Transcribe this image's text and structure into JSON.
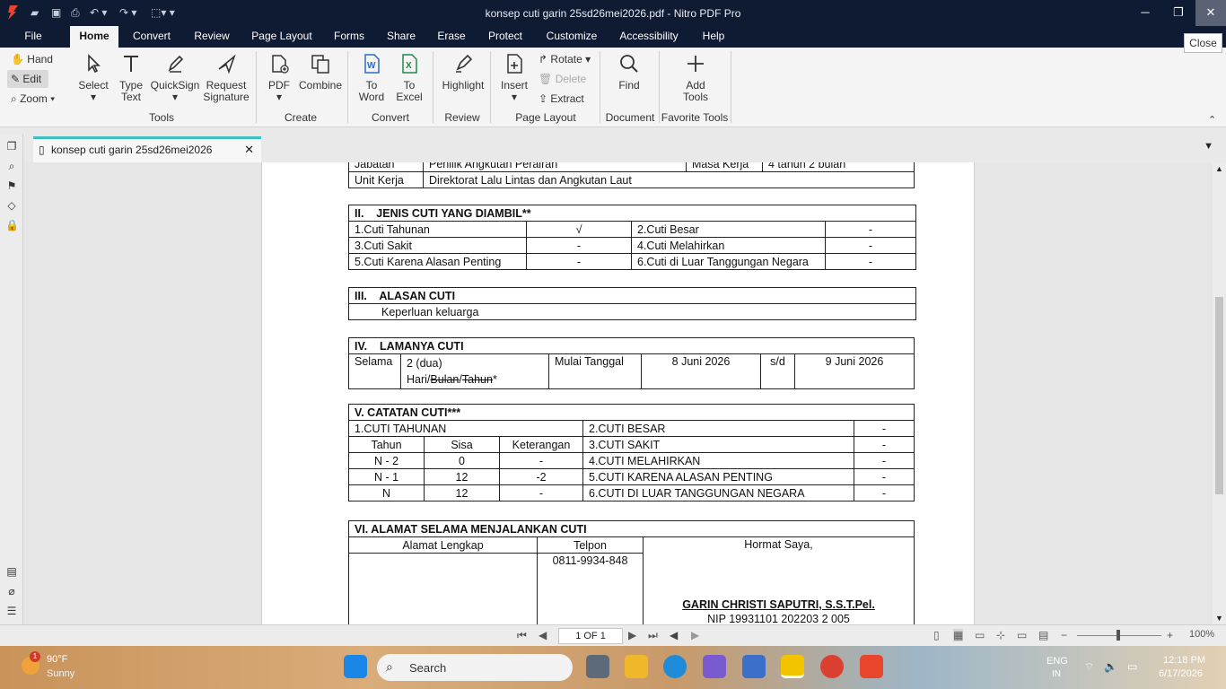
{
  "window": {
    "title": "konsep cuti garin 25sd26mei2026.pdf - Nitro PDF Pro",
    "close_tooltip": "Close"
  },
  "ribbon_tabs": [
    "File",
    "Home",
    "Convert",
    "Review",
    "Page Layout",
    "Forms",
    "Share",
    "Erase",
    "Protect",
    "Customize",
    "Accessibility",
    "Help"
  ],
  "ribbon": {
    "tools": {
      "hand": "Hand",
      "edit": "Edit",
      "zoom": "Zoom",
      "select": "Select",
      "type_text_1": "Type",
      "type_text_2": "Text",
      "quicksign": "QuickSign",
      "request_1": "Request",
      "request_2": "Signature",
      "label": "Tools"
    },
    "create": {
      "pdf": "PDF",
      "combine": "Combine",
      "label": "Create"
    },
    "convert": {
      "to_word_1": "To",
      "to_word_2": "Word",
      "to_excel_1": "To",
      "to_excel_2": "Excel",
      "label": "Convert"
    },
    "review": {
      "highlight": "Highlight",
      "label": "Review"
    },
    "page_layout": {
      "insert": "Insert",
      "rotate": "Rotate",
      "delete": "Delete",
      "extract": "Extract",
      "label": "Page Layout"
    },
    "document": {
      "find": "Find",
      "label": "Document"
    },
    "favorite": {
      "add_1": "Add",
      "add_2": "Tools",
      "label": "Favorite Tools"
    }
  },
  "doc_tab": {
    "label": "konsep cuti garin 25sd26mei2026"
  },
  "document": {
    "row_jabatan": {
      "label": "Jabatan",
      "value": "Penilik Angkutan Perairan",
      "masa_label": "Masa Kerja",
      "masa_value": "4 tahun 2 bulan"
    },
    "row_unit": {
      "label": "Unit Kerja",
      "value": "Direktorat Lalu Lintas dan Angkutan Laut"
    },
    "section2": {
      "title": "II.    JENIS CUTI YANG DIAMBIL**",
      "rows": [
        [
          "1.Cuti Tahunan",
          "√",
          "2.Cuti Besar",
          "-"
        ],
        [
          "3.Cuti Sakit",
          "-",
          "4.Cuti Melahirkan",
          "-"
        ],
        [
          "5.Cuti Karena Alasan Penting",
          "-",
          "6.Cuti di Luar Tanggungan Negara",
          "-"
        ]
      ]
    },
    "section3": {
      "title": "III.    ALASAN CUTI",
      "value": "Keperluan keluarga"
    },
    "section4": {
      "title": "IV.    LAMANYA CUTI",
      "selama": "Selama",
      "duration_1": "2 (dua)",
      "duration_hari": "Hari/",
      "duration_bulan": "Bulan",
      "duration_slash": "/",
      "duration_tahun": "Tahun",
      "duration_star": "*",
      "mulai_label": "Mulai Tanggal",
      "start": "8 Juni 2026",
      "sd": "s/d",
      "end": "9 Juni 2026"
    },
    "section5": {
      "title": "V. CATATAN CUTI***",
      "cuti_tahunan": "1.CUTI TAHUNAN",
      "headers": [
        "Tahun",
        "Sisa",
        "Keterangan"
      ],
      "rows": [
        [
          "N - 2",
          "0",
          "-"
        ],
        [
          "N - 1",
          "12",
          "-2"
        ],
        [
          "N",
          "12",
          "-"
        ]
      ],
      "right": [
        [
          "2.CUTI BESAR",
          "-"
        ],
        [
          "3.CUTI SAKIT",
          "-"
        ],
        [
          "4.CUTI MELAHIRKAN",
          "-"
        ],
        [
          "5.CUTI KARENA ALASAN PENTING",
          "-"
        ],
        [
          "6.CUTI DI LUAR TANGGUNGAN NEGARA",
          "-"
        ]
      ]
    },
    "section6": {
      "title": "VI. ALAMAT SELAMA MENJALANKAN CUTI",
      "alamat_header": "Alamat Lengkap",
      "telpon_header": "Telpon",
      "telpon_value": "0811-9934-848",
      "hormat": "Hormat Saya,",
      "signer": "GARIN CHRISTI SAPUTRI, S.S.T.Pel.",
      "nip_partial": "NIP 19931101 202203 2 005"
    }
  },
  "status": {
    "page_indicator": "1 OF 1",
    "zoom": "100%"
  },
  "taskbar": {
    "temp": "90°F",
    "weather": "Sunny",
    "search": "Search",
    "lang_1": "ENG",
    "lang_2": "IN",
    "time": "12:18 PM",
    "date": "6/17/2026",
    "badge": "1"
  }
}
